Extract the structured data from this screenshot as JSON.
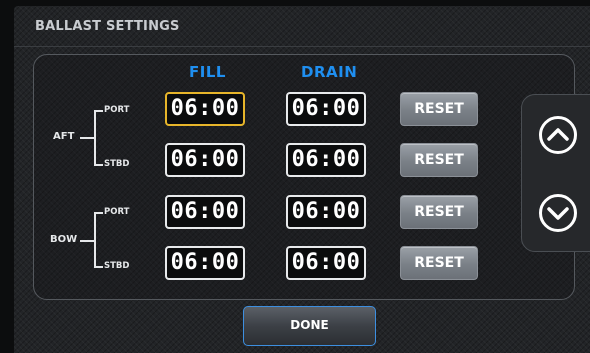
{
  "header": {
    "title": "BALLAST SETTINGS"
  },
  "columns": {
    "fill": "FILL",
    "drain": "DRAIN"
  },
  "groups": [
    {
      "label": "AFT",
      "rows": [
        {
          "label": "PORT",
          "fill": "06:00",
          "drain": "06:00",
          "reset": "RESET"
        },
        {
          "label": "STBD",
          "fill": "06:00",
          "drain": "06:00",
          "reset": "RESET"
        }
      ]
    },
    {
      "label": "BOW",
      "rows": [
        {
          "label": "PORT",
          "fill": "06:00",
          "drain": "06:00",
          "reset": "RESET"
        },
        {
          "label": "STBD",
          "fill": "06:00",
          "drain": "06:00",
          "reset": "RESET"
        }
      ]
    }
  ],
  "selected_field": "aft-port-fill",
  "scroll": {
    "up_icon": "chevron-up-circle-icon",
    "down_icon": "chevron-down-circle-icon"
  },
  "footer": {
    "done_label": "DONE"
  },
  "colors": {
    "accent_blue": "#1f8ff0",
    "selected_border": "#e7b52a",
    "button_gray": "#7a8087"
  }
}
